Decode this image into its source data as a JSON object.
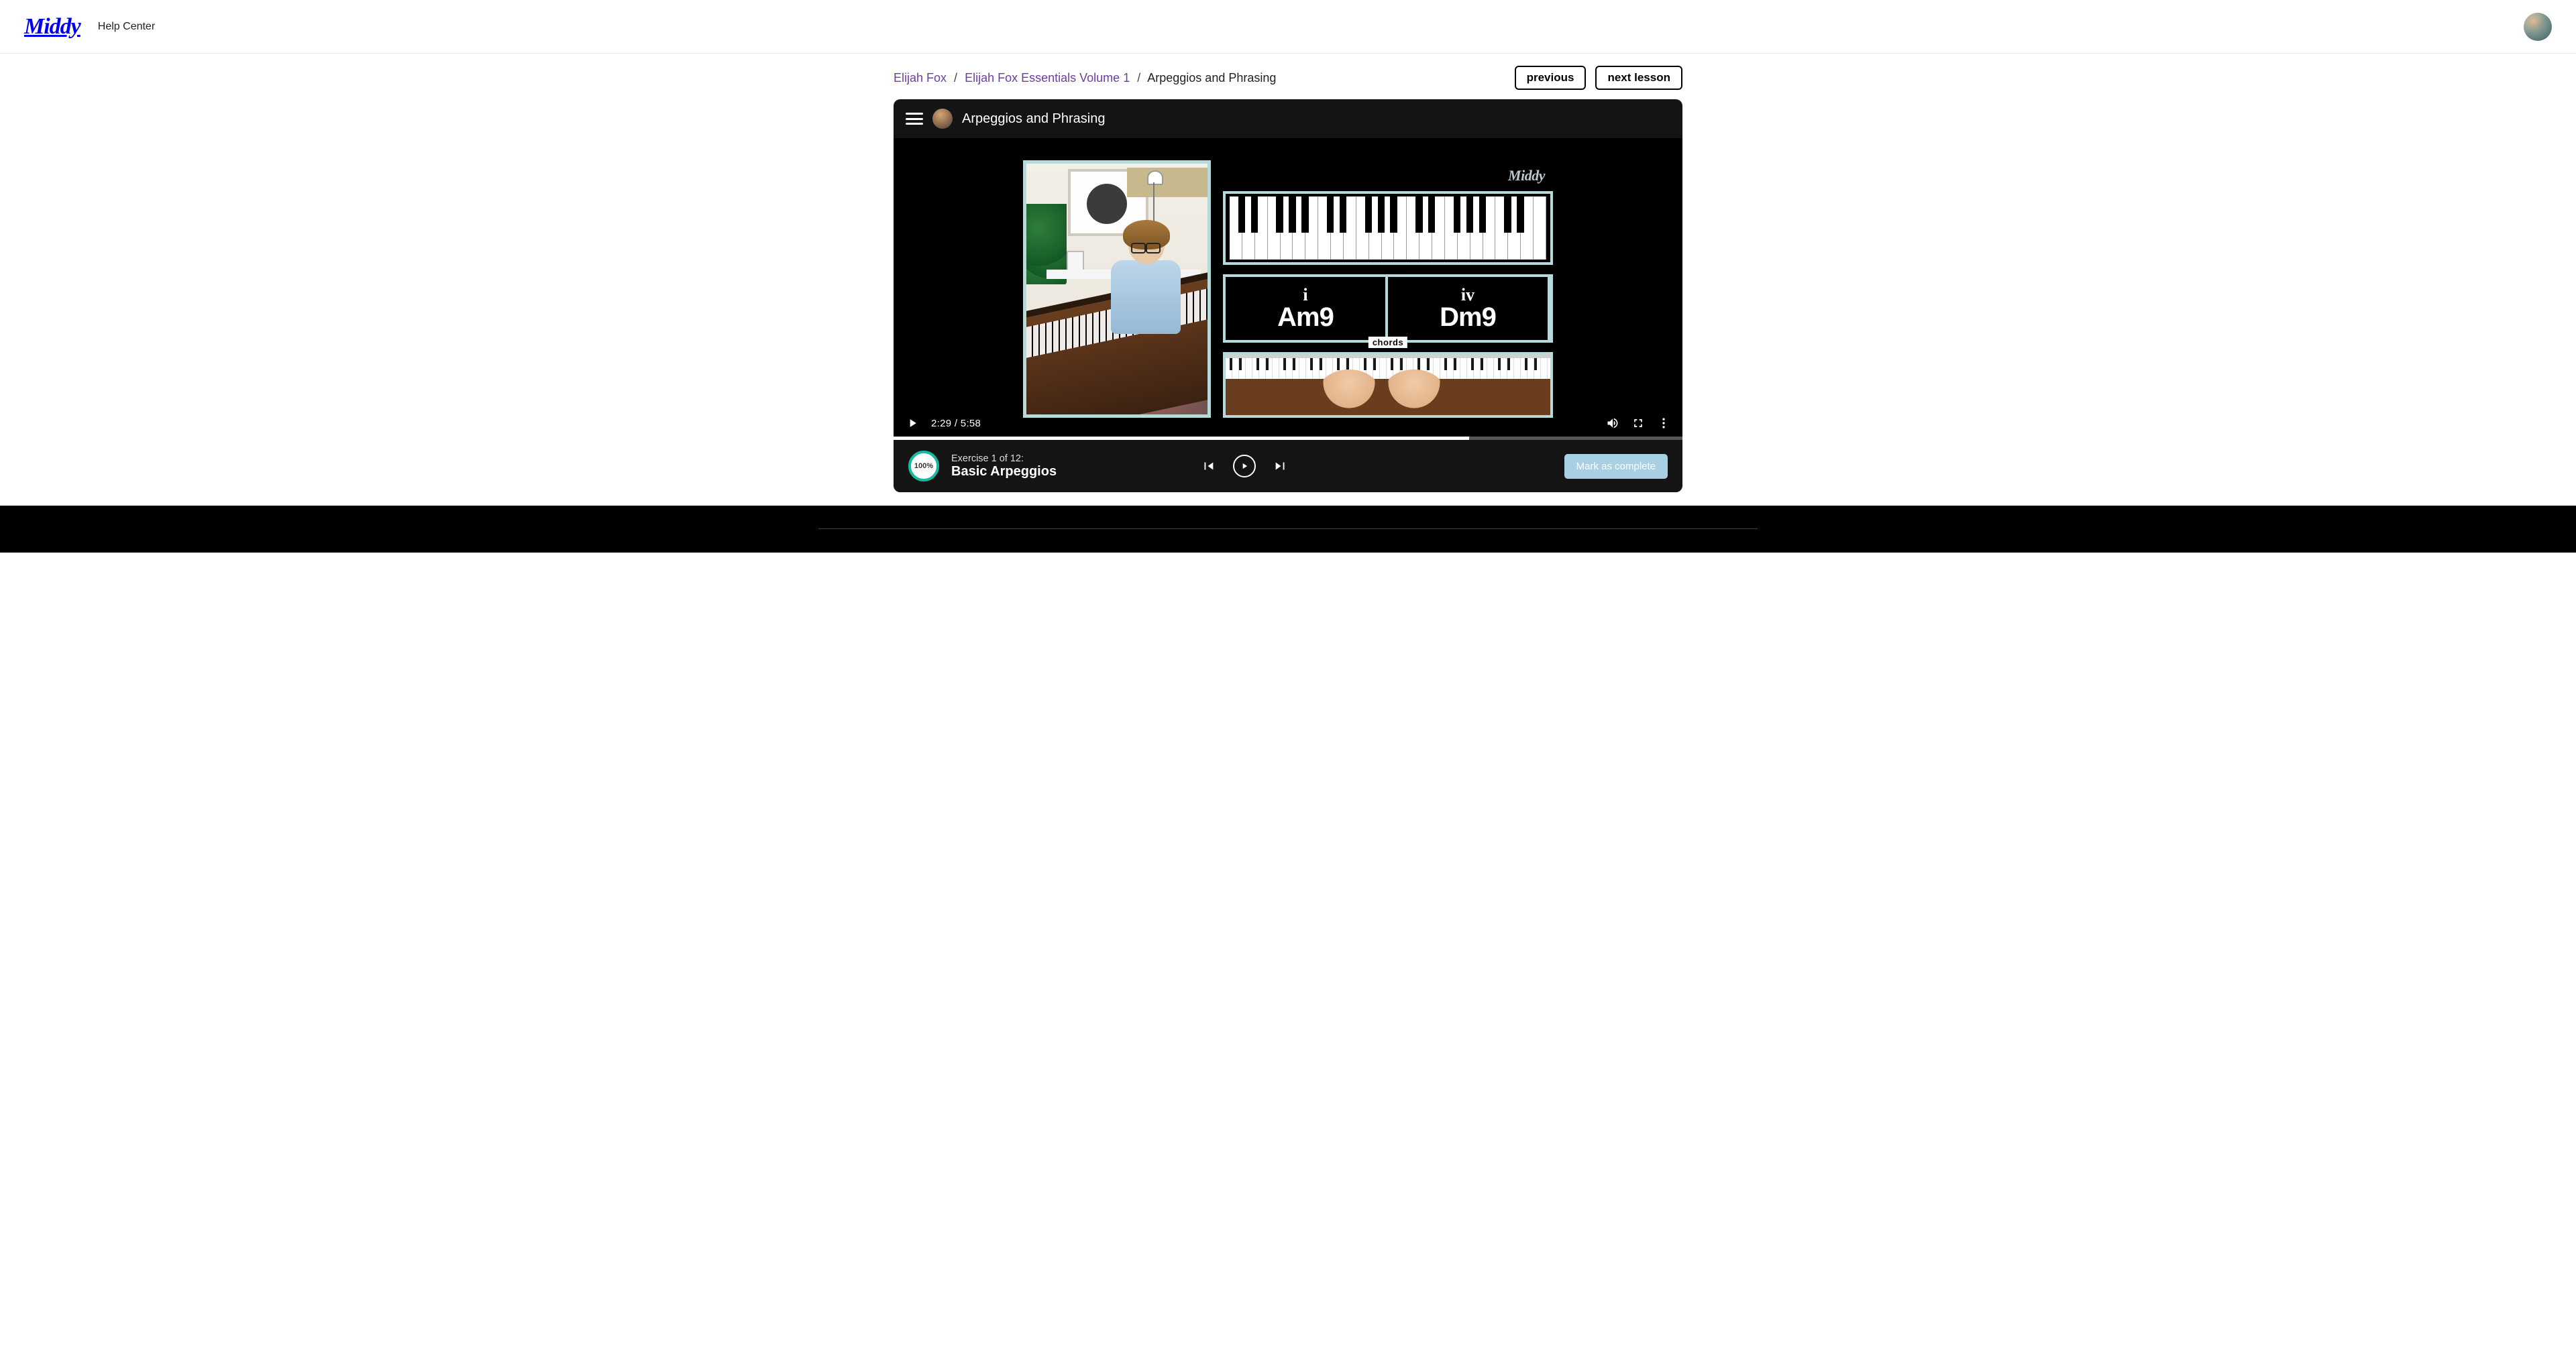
{
  "brand": "Middy",
  "nav": {
    "help": "Help Center"
  },
  "breadcrumb": {
    "artist": "Elijah Fox",
    "course": "Elijah Fox Essentials Volume 1",
    "lesson": "Arpeggios and Phrasing"
  },
  "lessonNav": {
    "prev": "previous",
    "next": "next lesson"
  },
  "player": {
    "title": "Arpeggios and Phrasing",
    "watermark": "Middy",
    "time": "2:29 / 5:58",
    "progressPercent": 73
  },
  "videoContent": {
    "chords": [
      {
        "numeral": "i",
        "name": "Am9"
      },
      {
        "numeral": "iv",
        "name": "Dm9"
      }
    ],
    "chordSectionLabel": "chords"
  },
  "exercise": {
    "tempoBadge": "100%",
    "line1": "Exercise 1 of 12:",
    "line2": "Basic Arpeggios",
    "markComplete": "Mark as complete"
  }
}
